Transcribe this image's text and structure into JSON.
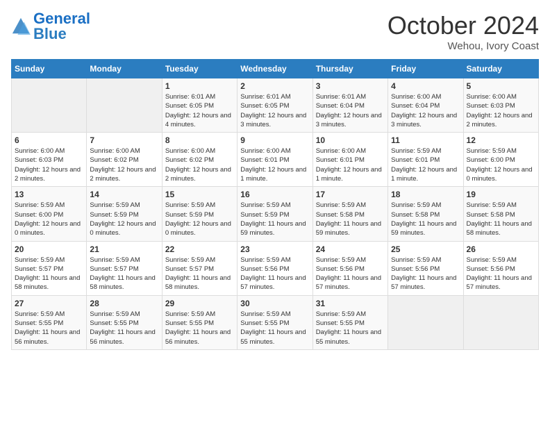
{
  "logo": {
    "text_general": "General",
    "text_blue": "Blue"
  },
  "title": "October 2024",
  "subtitle": "Wehou, Ivory Coast",
  "weekdays": [
    "Sunday",
    "Monday",
    "Tuesday",
    "Wednesday",
    "Thursday",
    "Friday",
    "Saturday"
  ],
  "weeks": [
    [
      {
        "day": "",
        "info": ""
      },
      {
        "day": "",
        "info": ""
      },
      {
        "day": "1",
        "info": "Sunrise: 6:01 AM\nSunset: 6:05 PM\nDaylight: 12 hours and 4 minutes."
      },
      {
        "day": "2",
        "info": "Sunrise: 6:01 AM\nSunset: 6:05 PM\nDaylight: 12 hours and 3 minutes."
      },
      {
        "day": "3",
        "info": "Sunrise: 6:01 AM\nSunset: 6:04 PM\nDaylight: 12 hours and 3 minutes."
      },
      {
        "day": "4",
        "info": "Sunrise: 6:00 AM\nSunset: 6:04 PM\nDaylight: 12 hours and 3 minutes."
      },
      {
        "day": "5",
        "info": "Sunrise: 6:00 AM\nSunset: 6:03 PM\nDaylight: 12 hours and 2 minutes."
      }
    ],
    [
      {
        "day": "6",
        "info": "Sunrise: 6:00 AM\nSunset: 6:03 PM\nDaylight: 12 hours and 2 minutes."
      },
      {
        "day": "7",
        "info": "Sunrise: 6:00 AM\nSunset: 6:02 PM\nDaylight: 12 hours and 2 minutes."
      },
      {
        "day": "8",
        "info": "Sunrise: 6:00 AM\nSunset: 6:02 PM\nDaylight: 12 hours and 2 minutes."
      },
      {
        "day": "9",
        "info": "Sunrise: 6:00 AM\nSunset: 6:01 PM\nDaylight: 12 hours and 1 minute."
      },
      {
        "day": "10",
        "info": "Sunrise: 6:00 AM\nSunset: 6:01 PM\nDaylight: 12 hours and 1 minute."
      },
      {
        "day": "11",
        "info": "Sunrise: 5:59 AM\nSunset: 6:01 PM\nDaylight: 12 hours and 1 minute."
      },
      {
        "day": "12",
        "info": "Sunrise: 5:59 AM\nSunset: 6:00 PM\nDaylight: 12 hours and 0 minutes."
      }
    ],
    [
      {
        "day": "13",
        "info": "Sunrise: 5:59 AM\nSunset: 6:00 PM\nDaylight: 12 hours and 0 minutes."
      },
      {
        "day": "14",
        "info": "Sunrise: 5:59 AM\nSunset: 5:59 PM\nDaylight: 12 hours and 0 minutes."
      },
      {
        "day": "15",
        "info": "Sunrise: 5:59 AM\nSunset: 5:59 PM\nDaylight: 12 hours and 0 minutes."
      },
      {
        "day": "16",
        "info": "Sunrise: 5:59 AM\nSunset: 5:59 PM\nDaylight: 11 hours and 59 minutes."
      },
      {
        "day": "17",
        "info": "Sunrise: 5:59 AM\nSunset: 5:58 PM\nDaylight: 11 hours and 59 minutes."
      },
      {
        "day": "18",
        "info": "Sunrise: 5:59 AM\nSunset: 5:58 PM\nDaylight: 11 hours and 59 minutes."
      },
      {
        "day": "19",
        "info": "Sunrise: 5:59 AM\nSunset: 5:58 PM\nDaylight: 11 hours and 58 minutes."
      }
    ],
    [
      {
        "day": "20",
        "info": "Sunrise: 5:59 AM\nSunset: 5:57 PM\nDaylight: 11 hours and 58 minutes."
      },
      {
        "day": "21",
        "info": "Sunrise: 5:59 AM\nSunset: 5:57 PM\nDaylight: 11 hours and 58 minutes."
      },
      {
        "day": "22",
        "info": "Sunrise: 5:59 AM\nSunset: 5:57 PM\nDaylight: 11 hours and 58 minutes."
      },
      {
        "day": "23",
        "info": "Sunrise: 5:59 AM\nSunset: 5:56 PM\nDaylight: 11 hours and 57 minutes."
      },
      {
        "day": "24",
        "info": "Sunrise: 5:59 AM\nSunset: 5:56 PM\nDaylight: 11 hours and 57 minutes."
      },
      {
        "day": "25",
        "info": "Sunrise: 5:59 AM\nSunset: 5:56 PM\nDaylight: 11 hours and 57 minutes."
      },
      {
        "day": "26",
        "info": "Sunrise: 5:59 AM\nSunset: 5:56 PM\nDaylight: 11 hours and 57 minutes."
      }
    ],
    [
      {
        "day": "27",
        "info": "Sunrise: 5:59 AM\nSunset: 5:55 PM\nDaylight: 11 hours and 56 minutes."
      },
      {
        "day": "28",
        "info": "Sunrise: 5:59 AM\nSunset: 5:55 PM\nDaylight: 11 hours and 56 minutes."
      },
      {
        "day": "29",
        "info": "Sunrise: 5:59 AM\nSunset: 5:55 PM\nDaylight: 11 hours and 56 minutes."
      },
      {
        "day": "30",
        "info": "Sunrise: 5:59 AM\nSunset: 5:55 PM\nDaylight: 11 hours and 55 minutes."
      },
      {
        "day": "31",
        "info": "Sunrise: 5:59 AM\nSunset: 5:55 PM\nDaylight: 11 hours and 55 minutes."
      },
      {
        "day": "",
        "info": ""
      },
      {
        "day": "",
        "info": ""
      }
    ]
  ]
}
